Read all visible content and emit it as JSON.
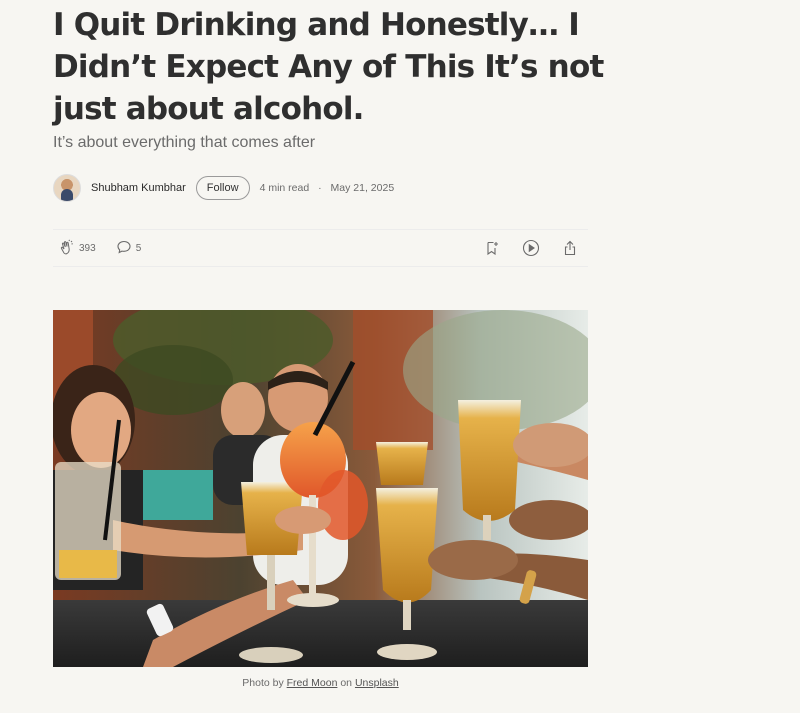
{
  "article": {
    "title": "I Quit Drinking and Honestly… I Didn’t Expect Any of This It’s not just about alcohol.",
    "subtitle": "It’s about everything that comes after"
  },
  "byline": {
    "author": "Shubham Kumbhar",
    "follow_label": "Follow",
    "read_time": "4 min read",
    "separator": "·",
    "date": "May 21, 2025"
  },
  "actions": {
    "claps": "393",
    "responses": "5",
    "icons": [
      "clap-icon",
      "comment-icon",
      "bookmark-add-icon",
      "play-icon",
      "share-icon"
    ]
  },
  "image": {
    "description": "Group of friends toasting with beers and cocktails",
    "caption_prefix": "Photo by",
    "photographer": "Fred Moon",
    "caption_mid": "on",
    "source": "Unsplash"
  },
  "colors": {
    "background": "#f7f6f2",
    "title": "#2f2f2f",
    "muted": "#6b6b6b"
  }
}
